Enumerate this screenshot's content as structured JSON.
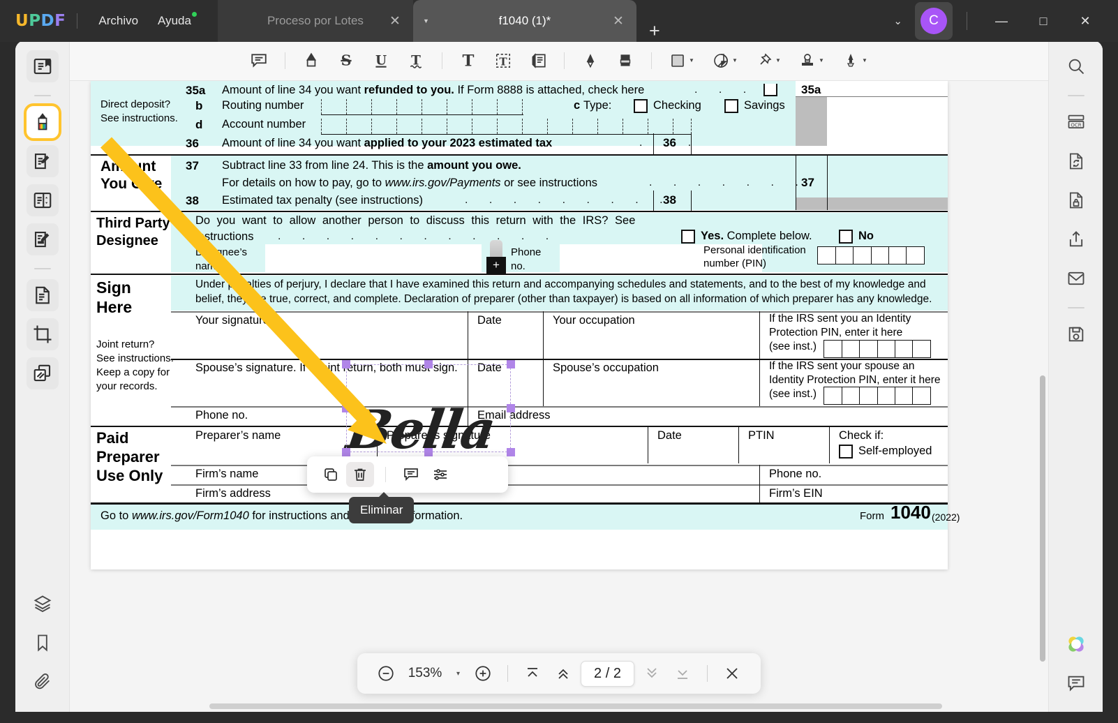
{
  "app": {
    "logo": {
      "letters": [
        "U",
        "P",
        "D",
        "F"
      ],
      "colors": [
        "#f5b72b",
        "#4ec99a",
        "#5aa9f0",
        "#9b7ff0"
      ]
    },
    "menus": [
      {
        "label": "Archivo",
        "badge": false
      },
      {
        "label": "Ayuda",
        "badge": true
      }
    ],
    "tabs": [
      {
        "label": "Proceso por Lotes",
        "active": false,
        "close": "✕"
      },
      {
        "label": "f1040 (1)*",
        "active": true,
        "close": "✕"
      }
    ],
    "new_tab_label": "+",
    "account": {
      "initial": "C",
      "color": "#a855f7"
    },
    "window_controls": {
      "minimize": "—",
      "maximize": "□",
      "close": "✕"
    },
    "overflow_caret": "⌄"
  },
  "left_rail": [
    {
      "name": "reader-mode-icon",
      "label": "Lector"
    },
    {
      "name": "annotate-highlighter-icon",
      "label": "Comentario",
      "active": true
    },
    {
      "name": "edit-pdf-icon",
      "label": "Editar PDF"
    },
    {
      "name": "page-organize-icon",
      "label": "Organizar páginas"
    },
    {
      "name": "form-fill-icon",
      "label": "Rellenar y firmar"
    },
    {
      "name": "convert-page-icon",
      "label": "Convertir"
    },
    {
      "name": "crop-icon",
      "label": "Recortar"
    },
    {
      "name": "pages-stack-icon",
      "label": "Páginas"
    }
  ],
  "left_rail_bottom": [
    {
      "name": "layers-icon",
      "label": "Capas"
    },
    {
      "name": "bookmark-icon",
      "label": "Marcadores"
    },
    {
      "name": "attachment-icon",
      "label": "Archivos adjuntos"
    }
  ],
  "toolbar": [
    {
      "name": "comment-icon",
      "label": "Nota"
    },
    {
      "name": "highlighter-icon",
      "label": "Resaltar"
    },
    {
      "name": "strikethrough-icon",
      "label": "Tachado"
    },
    {
      "name": "underline-icon",
      "label": "Subrayado"
    },
    {
      "name": "squiggly-underline-icon",
      "label": "Subrayado ondulado"
    },
    {
      "name": "text-tool-icon",
      "label": "Texto"
    },
    {
      "name": "text-box-icon",
      "label": "Cuadro de texto"
    },
    {
      "name": "sticky-note-icon",
      "label": "Llamada"
    },
    {
      "name": "pencil-icon",
      "label": "Lápiz"
    },
    {
      "name": "eraser-icon",
      "label": "Borrador"
    },
    {
      "name": "shape-icon",
      "label": "Formas",
      "caret": true
    },
    {
      "name": "sticker-icon",
      "label": "Adhesivo",
      "caret": true
    },
    {
      "name": "pin-icon",
      "label": "Sello de chincheta",
      "caret": true
    },
    {
      "name": "stamp-icon",
      "label": "Sello",
      "caret": true
    },
    {
      "name": "signature-pen-icon",
      "label": "Firma",
      "caret": true
    }
  ],
  "right_rail": [
    {
      "name": "search-icon",
      "label": "Buscar"
    },
    {
      "name": "ocr-icon",
      "label": "OCR"
    },
    {
      "name": "convert-icon",
      "label": "Convertir"
    },
    {
      "name": "protect-icon",
      "label": "Proteger"
    },
    {
      "name": "share-icon",
      "label": "Compartir"
    },
    {
      "name": "email-icon",
      "label": "Correo"
    },
    {
      "name": "save-icon",
      "label": "Guardar"
    }
  ],
  "right_rail_bottom": [
    {
      "name": "ai-assistant-icon",
      "label": "Asistente IA"
    },
    {
      "name": "comment-panel-icon",
      "label": "Comentarios"
    }
  ],
  "popup_toolbar": {
    "buttons": [
      {
        "name": "copy-button",
        "label": "Copiar",
        "hover": false
      },
      {
        "name": "delete-button",
        "label": "Eliminar",
        "hover": true
      },
      {
        "name": "note-button",
        "label": "Nota",
        "hover": false
      },
      {
        "name": "properties-button",
        "label": "Propiedades",
        "hover": false
      }
    ],
    "tooltip": "Eliminar"
  },
  "page_bar": {
    "zoom_out": "−",
    "zoom_value": "153%",
    "zoom_caret": "▾",
    "zoom_in": "+",
    "first_page": "first-page",
    "prev_page": "prev-page",
    "page_indicator": "2 / 2",
    "next_page": "next-page",
    "last_page": "last-page",
    "close": "✕"
  },
  "document": {
    "annotation": {
      "type": "arrow",
      "color": "#fcc21b"
    },
    "signature": {
      "text": "Bella",
      "selected": true,
      "handle_color": "#b085e8"
    },
    "form": {
      "line35a": {
        "num": "35a",
        "text_pre": "Amount of line 34 you want ",
        "text_bold": "refunded to you.",
        "text_post": " If Form 8888 is attached, check here",
        "box_label": "35a"
      },
      "line35b": {
        "num": "b",
        "label": "Routing number"
      },
      "line35c": {
        "num": "c",
        "label": "Type:",
        "options": [
          "Checking",
          "Savings"
        ]
      },
      "line35d": {
        "num": "d",
        "label": "Account number"
      },
      "line36": {
        "num": "36",
        "text_pre": "Amount of line 34 you want ",
        "text_bold": "applied to your 2023 estimated tax",
        "box_label": "36"
      },
      "direct_deposit_note": [
        "Direct deposit?",
        "See instructions."
      ],
      "amount_you_owe": [
        "Amount",
        "You Owe"
      ],
      "line37": {
        "num": "37",
        "l1_pre": "Subtract line 33 from line 24. This is the ",
        "l1_bold": "amount you owe.",
        "l2_pre": "For details on how to pay, go to ",
        "l2_italic": "www.irs.gov/Payments",
        "l2_post": " or see instructions",
        "box_label": "37"
      },
      "line38": {
        "num": "38",
        "label": "Estimated tax penalty (see instructions)",
        "box_label": "38"
      },
      "third_party": {
        "heading": [
          "Third Party",
          "Designee"
        ],
        "question_l1": "Do you want to allow another person to discuss this return with the IRS? See",
        "question_l2": "instructions",
        "yes_label": "Yes.",
        "yes_rest": " Complete below.",
        "no_label": "No",
        "designee_name": [
          "Designee’s",
          "name"
        ],
        "phone": [
          "Phone",
          "no."
        ],
        "pin": [
          "Personal identification",
          "number (PIN)"
        ]
      },
      "sign_here": {
        "heading": [
          "Sign",
          "Here"
        ],
        "note": [
          "Joint return?",
          "See instructions.",
          "Keep a copy for",
          "your records."
        ],
        "declaration_l1": "Under penalties of perjury, I declare that I have examined this return and accompanying schedules and statements, and to the best of my knowledge and",
        "declaration_l2": "belief, they are true, correct, and complete. Declaration of preparer (other than taxpayer) is based on all information of which preparer has any knowledge.",
        "your_signature": "Your signature",
        "spouse_signature": "Spouse’s signature. If a joint return, both must sign.",
        "date": "Date",
        "your_occupation": "Your occupation",
        "spouse_occupation": "Spouse’s occupation",
        "ip_pin_you": [
          "If the IRS sent you an Identity",
          "Protection PIN, enter it here",
          "(see inst.)"
        ],
        "ip_pin_spouse": [
          "If the IRS sent your spouse an",
          "Identity Protection PIN, enter it here",
          "(see inst.)"
        ],
        "phone_no": "Phone no.",
        "email": "Email address"
      },
      "paid_preparer": {
        "heading": [
          "Paid",
          "Preparer",
          "Use Only"
        ],
        "preparer_name": "Preparer’s name",
        "preparer_signature": "Preparer’s signature",
        "date": "Date",
        "ptin": "PTIN",
        "check_if": "Check if:",
        "self_employed": "Self-employed",
        "firm_name": "Firm’s name",
        "firm_address": "Firm’s address",
        "phone_no": "Phone no.",
        "firm_ein": "Firm’s EIN"
      },
      "footer": {
        "goto_pre": "Go to ",
        "goto_link": "www.irs.gov/Form1040",
        "goto_post": " for instructions and the latest information.",
        "form_word": "Form",
        "form_num": "1040",
        "form_year": "(2022)"
      }
    }
  }
}
